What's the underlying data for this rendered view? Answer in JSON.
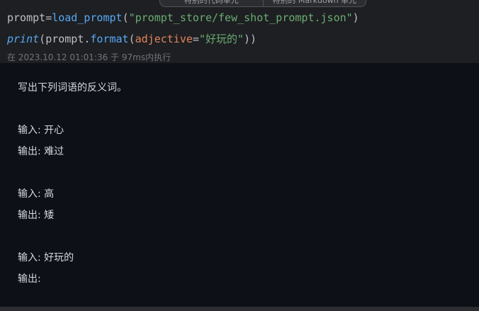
{
  "toolbar": {
    "left_label": "特别的代码单元",
    "right_label": "特别的 Markdown 单元"
  },
  "code": {
    "line1": {
      "var": "prompt",
      "eq": "=",
      "fn": "load_prompt",
      "open": "(",
      "str": "\"prompt_store/few_shot_prompt.json\"",
      "close": ")"
    },
    "line2": {
      "kw": "print",
      "open": "(",
      "obj": "prompt.",
      "method": "format",
      "open2": "(",
      "param": "adjective",
      "eq": "=",
      "str": "\"好玩的\"",
      "close": "))"
    },
    "status": "在 2023.10.12 01:01:36 于 97ms内执行"
  },
  "output": {
    "lines": [
      "写出下列词语的反义词。",
      "",
      "输入: 开心",
      "输出: 难过",
      "",
      "输入: 高",
      "输出: 矮",
      "",
      "输入: 好玩的",
      "输出:"
    ]
  }
}
